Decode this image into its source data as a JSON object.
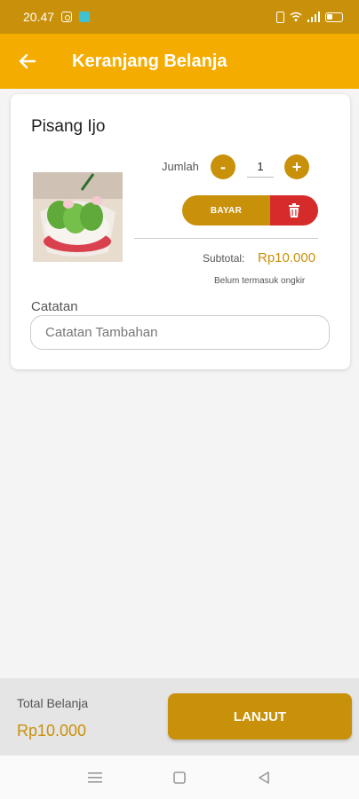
{
  "status_bar": {
    "time": "20.47"
  },
  "app_bar": {
    "title": "Keranjang Belanja"
  },
  "cart_item": {
    "name": "Pisang Ijo",
    "quantity_label": "Jumlah",
    "quantity_value": "1",
    "minus_symbol": "-",
    "plus_symbol": "+",
    "pay_label": "BAYAR",
    "subtotal_label": "Subtotal:",
    "subtotal_value": "Rp10.000",
    "ongkir_note": "Belum termasuk ongkir",
    "notes_label": "Catatan",
    "notes_placeholder": "Catatan Tambahan",
    "notes_value": ""
  },
  "footer": {
    "total_label": "Total Belanja",
    "total_value": "Rp10.000",
    "next_label": "LANJUT"
  },
  "colors": {
    "accent": "#c9900a",
    "app_bar": "#f5ac00",
    "delete": "#d62b2b"
  },
  "icons": {
    "back": "arrow-left-icon",
    "delete": "trash-icon",
    "nav_menu": "menu-icon",
    "nav_home": "square-home-icon",
    "nav_back": "triangle-back-icon"
  }
}
